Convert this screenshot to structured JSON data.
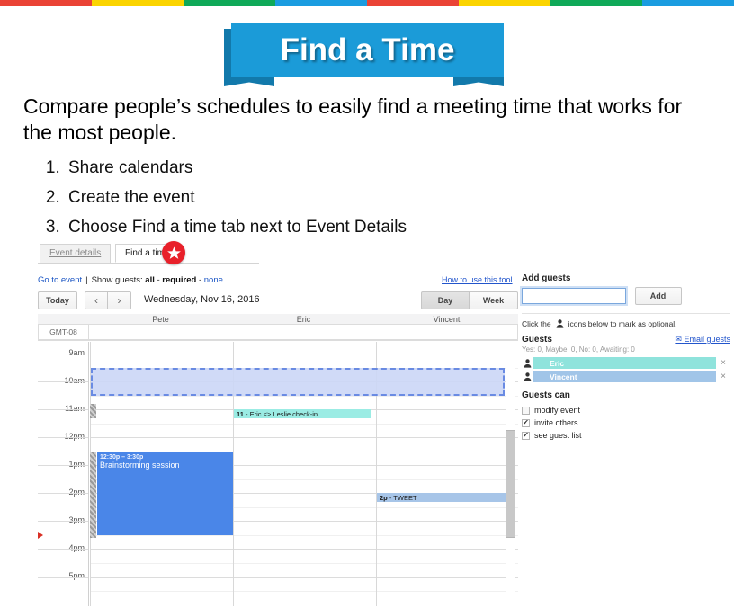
{
  "topbar": {
    "colors": [
      "#ea4335",
      "#fbd400",
      "#0fa958",
      "#1a9ce0",
      "#ea4335",
      "#fbd400",
      "#0fa958",
      "#1a9ce0"
    ]
  },
  "banner": {
    "title": "Find a Time",
    "fill_color": "#1b9bd8",
    "ribbon_color": "#1279ab"
  },
  "lead": "Compare people’s schedules to easily find a meeting time that works for the most people.",
  "steps": [
    "Share calendars",
    "Create the event",
    "Choose Find a time tab next to Event Details"
  ],
  "screenshot": {
    "tabs": {
      "inactive": "Event details",
      "active": "Find a time",
      "badge_icon": "star-icon",
      "badge_color": "#e8202a"
    },
    "status": {
      "go_to_event": "Go to event",
      "separator": "|",
      "show_guests_label": "Show guests:",
      "option_all": "all",
      "dash1": "-",
      "option_required": "required",
      "dash2": "-",
      "option_none": "none",
      "how_to": "How to use this tool"
    },
    "toolbar": {
      "today": "Today",
      "prev": "‹",
      "next": "›",
      "date": "Wednesday, Nov 16, 2016",
      "day": "Day",
      "week": "Week"
    },
    "calendar": {
      "timezone": "GMT-08",
      "columns": [
        "Pete",
        "Eric",
        "Vincent"
      ],
      "time_labels": [
        "9am",
        "10am",
        "11am",
        "12pm",
        "1pm",
        "2pm",
        "3pm",
        "4pm",
        "5pm"
      ],
      "proposed_block": {
        "label": "",
        "start": "9:30am",
        "end": "10:30am",
        "fill": "#ccd7f7",
        "border": "#5a7fe0"
      },
      "events": [
        {
          "owner": "Pete",
          "time": "12:30p – 3:30p",
          "title": "Brainstorming session",
          "color": "#4a86e8"
        },
        {
          "owner": "Eric",
          "time": "11",
          "title": "- Eric <> Leslie check-in",
          "color": "#9bece4"
        },
        {
          "owner": "Vincent",
          "time": "2p",
          "title": "- TWEET",
          "color": "#a7c5e8"
        }
      ]
    },
    "panel": {
      "add_guests_title": "Add guests",
      "add_guests_value": "",
      "add_guests_placeholder": "",
      "add_button": "Add",
      "optional_hint_before": "Click the",
      "optional_hint_after": "icons below to mark as optional.",
      "guests_title": "Guests",
      "email_guests": "Email guests",
      "rsvp_summary": "Yes: 0, Maybe: 0, No: 0, Awaiting: 0",
      "guest_list": [
        {
          "name": "Eric",
          "color": "#8fe3dc",
          "remove": "×"
        },
        {
          "name": "Vincent",
          "color": "#a1c5e8",
          "remove": "×"
        }
      ],
      "guests_can_title": "Guests can",
      "permissions": [
        {
          "label": "modify event",
          "checked": false
        },
        {
          "label": "invite others",
          "checked": true
        },
        {
          "label": "see guest list",
          "checked": true
        }
      ]
    }
  }
}
